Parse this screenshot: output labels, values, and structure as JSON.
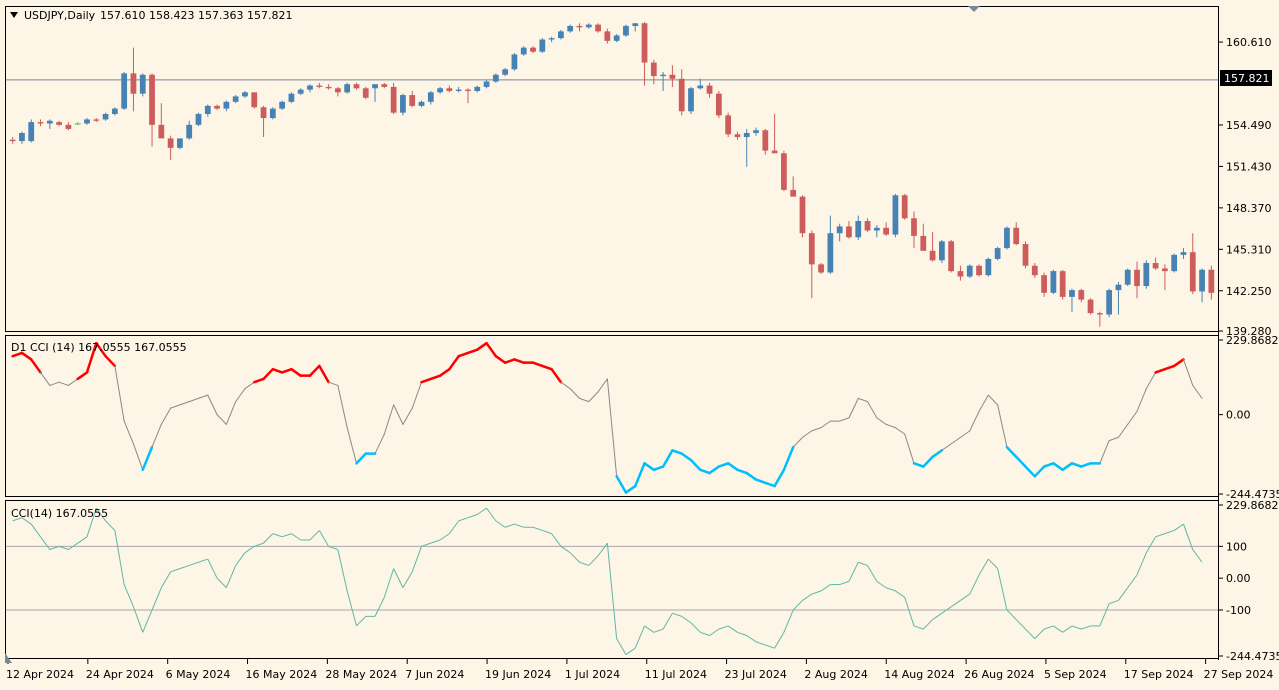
{
  "symbol_header": "USDJPY,Daily",
  "ohlc_readout": "157.610 158.423 157.363 157.821",
  "current_price_label": "157.821",
  "cci_d1_legend": "D1 CCI (14) 167.0555 167.0555",
  "cci_legend": "CCI(14) 167.0555",
  "colors": {
    "background": "#fdf5e6",
    "bull_candle": "#4682b4",
    "bear_candle": "#cd5c5c",
    "doji_candle": "#32cd32",
    "cci_upper": "#ff0000",
    "cci_lower": "#00bfff",
    "cci_neutral": "#8a8a8a",
    "cci_line": "#5fb8a8",
    "level_line": "#a9a9a9",
    "price_line": "#778899"
  },
  "chart_data": [
    {
      "type": "candlestick",
      "title": "USDJPY,Daily",
      "price_ticks": [
        "160.610",
        "157.821",
        "154.490",
        "151.430",
        "148.370",
        "145.310",
        "142.250",
        "139.280"
      ],
      "ylim": [
        139.28,
        163.2
      ],
      "current_price": 157.821,
      "candles": [
        {
          "o": 153.4,
          "h": 153.6,
          "l": 153.1,
          "c": 153.3
        },
        {
          "o": 153.3,
          "h": 154.0,
          "l": 153.1,
          "c": 153.9
        },
        {
          "o": 153.3,
          "h": 154.9,
          "l": 153.2,
          "c": 154.7
        },
        {
          "o": 154.7,
          "h": 154.9,
          "l": 154.4,
          "c": 154.6
        },
        {
          "o": 154.6,
          "h": 154.9,
          "l": 154.2,
          "c": 154.8
        },
        {
          "o": 154.7,
          "h": 154.8,
          "l": 154.4,
          "c": 154.5
        },
        {
          "o": 154.5,
          "h": 154.7,
          "l": 154.1,
          "c": 154.2
        },
        {
          "o": 154.6,
          "h": 154.7,
          "l": 154.5,
          "c": 154.6
        },
        {
          "o": 154.6,
          "h": 155.0,
          "l": 154.5,
          "c": 154.9
        },
        {
          "o": 154.9,
          "h": 155.0,
          "l": 154.7,
          "c": 154.8
        },
        {
          "o": 154.9,
          "h": 155.4,
          "l": 154.8,
          "c": 155.3
        },
        {
          "o": 155.3,
          "h": 155.8,
          "l": 155.2,
          "c": 155.7
        },
        {
          "o": 155.7,
          "h": 158.4,
          "l": 155.6,
          "c": 158.3
        },
        {
          "o": 158.3,
          "h": 160.2,
          "l": 155.5,
          "c": 156.8
        },
        {
          "o": 156.8,
          "h": 158.3,
          "l": 156.6,
          "c": 158.2
        },
        {
          "o": 158.2,
          "h": 158.3,
          "l": 152.9,
          "c": 154.5
        },
        {
          "o": 154.5,
          "h": 156.1,
          "l": 153.6,
          "c": 153.5
        },
        {
          "o": 153.5,
          "h": 153.7,
          "l": 151.9,
          "c": 152.8
        },
        {
          "o": 152.8,
          "h": 153.4,
          "l": 152.7,
          "c": 153.5
        },
        {
          "o": 153.5,
          "h": 154.8,
          "l": 153.4,
          "c": 154.5
        },
        {
          "o": 154.5,
          "h": 155.4,
          "l": 154.4,
          "c": 155.3
        },
        {
          "o": 155.3,
          "h": 156.0,
          "l": 155.1,
          "c": 155.9
        },
        {
          "o": 155.9,
          "h": 156.0,
          "l": 155.6,
          "c": 155.7
        },
        {
          "o": 155.7,
          "h": 156.3,
          "l": 155.5,
          "c": 156.2
        },
        {
          "o": 156.2,
          "h": 156.7,
          "l": 156.1,
          "c": 156.6
        },
        {
          "o": 156.6,
          "h": 157.0,
          "l": 156.5,
          "c": 156.9
        },
        {
          "o": 156.9,
          "h": 156.9,
          "l": 155.7,
          "c": 155.8
        },
        {
          "o": 155.8,
          "h": 155.9,
          "l": 153.6,
          "c": 155.0
        },
        {
          "o": 155.0,
          "h": 155.8,
          "l": 154.9,
          "c": 155.7
        },
        {
          "o": 155.7,
          "h": 156.3,
          "l": 155.6,
          "c": 156.2
        },
        {
          "o": 156.2,
          "h": 156.9,
          "l": 156.1,
          "c": 156.8
        },
        {
          "o": 156.8,
          "h": 157.2,
          "l": 156.7,
          "c": 157.1
        },
        {
          "o": 157.1,
          "h": 157.5,
          "l": 156.9,
          "c": 157.4
        },
        {
          "o": 157.4,
          "h": 157.6,
          "l": 157.2,
          "c": 157.3
        },
        {
          "o": 157.3,
          "h": 157.5,
          "l": 157.1,
          "c": 157.2
        },
        {
          "o": 157.2,
          "h": 157.3,
          "l": 156.6,
          "c": 156.9
        },
        {
          "o": 156.9,
          "h": 157.6,
          "l": 156.8,
          "c": 157.5
        },
        {
          "o": 157.5,
          "h": 157.6,
          "l": 157.1,
          "c": 157.2
        },
        {
          "o": 157.2,
          "h": 157.3,
          "l": 156.4,
          "c": 156.5
        },
        {
          "o": 157.2,
          "h": 157.5,
          "l": 156.2,
          "c": 157.5
        },
        {
          "o": 157.5,
          "h": 157.6,
          "l": 157.2,
          "c": 157.3
        },
        {
          "o": 157.3,
          "h": 157.6,
          "l": 155.3,
          "c": 155.4
        },
        {
          "o": 155.4,
          "h": 156.8,
          "l": 155.2,
          "c": 156.7
        },
        {
          "o": 156.7,
          "h": 157.0,
          "l": 155.8,
          "c": 155.9
        },
        {
          "o": 155.9,
          "h": 156.3,
          "l": 155.8,
          "c": 156.2
        },
        {
          "o": 156.2,
          "h": 157.0,
          "l": 156.0,
          "c": 156.9
        },
        {
          "o": 156.9,
          "h": 157.3,
          "l": 156.8,
          "c": 157.2
        },
        {
          "o": 157.2,
          "h": 157.4,
          "l": 156.9,
          "c": 157.0
        },
        {
          "o": 157.0,
          "h": 157.3,
          "l": 156.9,
          "c": 157.1
        },
        {
          "o": 157.1,
          "h": 157.2,
          "l": 156.1,
          "c": 157.0
        },
        {
          "o": 157.0,
          "h": 157.4,
          "l": 156.9,
          "c": 157.3
        },
        {
          "o": 157.3,
          "h": 157.8,
          "l": 157.2,
          "c": 157.7
        },
        {
          "o": 157.7,
          "h": 158.3,
          "l": 157.6,
          "c": 158.2
        },
        {
          "o": 158.2,
          "h": 158.7,
          "l": 158.1,
          "c": 158.6
        },
        {
          "o": 158.6,
          "h": 159.8,
          "l": 158.5,
          "c": 159.7
        },
        {
          "o": 159.7,
          "h": 160.3,
          "l": 159.6,
          "c": 160.2
        },
        {
          "o": 160.2,
          "h": 160.3,
          "l": 159.8,
          "c": 159.9
        },
        {
          "o": 159.9,
          "h": 160.9,
          "l": 159.8,
          "c": 160.8
        },
        {
          "o": 160.8,
          "h": 161.0,
          "l": 160.6,
          "c": 160.9
        },
        {
          "o": 160.9,
          "h": 161.5,
          "l": 160.8,
          "c": 161.4
        },
        {
          "o": 161.4,
          "h": 161.9,
          "l": 161.3,
          "c": 161.8
        },
        {
          "o": 161.8,
          "h": 162.0,
          "l": 161.4,
          "c": 161.7
        },
        {
          "o": 161.7,
          "h": 162.0,
          "l": 161.6,
          "c": 161.9
        },
        {
          "o": 161.9,
          "h": 162.0,
          "l": 161.3,
          "c": 161.4
        },
        {
          "o": 161.4,
          "h": 161.6,
          "l": 160.5,
          "c": 160.7
        },
        {
          "o": 160.7,
          "h": 161.2,
          "l": 160.6,
          "c": 161.1
        },
        {
          "o": 161.1,
          "h": 161.9,
          "l": 161.0,
          "c": 161.8
        },
        {
          "o": 161.8,
          "h": 162.0,
          "l": 161.4,
          "c": 162.0
        },
        {
          "o": 162.0,
          "h": 162.1,
          "l": 157.4,
          "c": 159.1
        },
        {
          "o": 159.1,
          "h": 159.3,
          "l": 157.5,
          "c": 158.1
        },
        {
          "o": 158.1,
          "h": 158.4,
          "l": 157.0,
          "c": 158.2
        },
        {
          "o": 158.2,
          "h": 158.9,
          "l": 157.3,
          "c": 157.9
        },
        {
          "o": 157.9,
          "h": 158.6,
          "l": 155.2,
          "c": 155.5
        },
        {
          "o": 155.5,
          "h": 157.3,
          "l": 155.3,
          "c": 157.2
        },
        {
          "o": 157.2,
          "h": 157.9,
          "l": 157.1,
          "c": 157.4
        },
        {
          "o": 157.4,
          "h": 157.6,
          "l": 156.5,
          "c": 156.8
        },
        {
          "o": 156.8,
          "h": 157.0,
          "l": 155.0,
          "c": 155.2
        },
        {
          "o": 155.2,
          "h": 155.4,
          "l": 153.6,
          "c": 153.8
        },
        {
          "o": 153.8,
          "h": 154.0,
          "l": 153.4,
          "c": 153.6
        },
        {
          "o": 153.6,
          "h": 154.2,
          "l": 151.4,
          "c": 153.9
        },
        {
          "o": 153.9,
          "h": 154.3,
          "l": 153.7,
          "c": 154.1
        },
        {
          "o": 154.1,
          "h": 154.2,
          "l": 152.3,
          "c": 152.6
        },
        {
          "o": 152.6,
          "h": 155.3,
          "l": 152.5,
          "c": 152.4
        },
        {
          "o": 152.4,
          "h": 152.6,
          "l": 149.6,
          "c": 149.7
        },
        {
          "o": 149.7,
          "h": 150.7,
          "l": 149.2,
          "c": 149.2
        },
        {
          "o": 149.2,
          "h": 149.3,
          "l": 146.2,
          "c": 146.5
        },
        {
          "o": 146.5,
          "h": 146.7,
          "l": 141.7,
          "c": 144.2
        },
        {
          "o": 144.2,
          "h": 144.3,
          "l": 143.5,
          "c": 143.6
        },
        {
          "o": 143.6,
          "h": 147.8,
          "l": 143.5,
          "c": 146.5
        },
        {
          "o": 146.5,
          "h": 147.2,
          "l": 145.9,
          "c": 147.0
        },
        {
          "o": 147.0,
          "h": 147.4,
          "l": 146.1,
          "c": 146.2
        },
        {
          "o": 146.2,
          "h": 147.8,
          "l": 146.0,
          "c": 147.4
        },
        {
          "o": 147.4,
          "h": 147.6,
          "l": 146.6,
          "c": 146.7
        },
        {
          "o": 146.7,
          "h": 147.1,
          "l": 146.2,
          "c": 146.9
        },
        {
          "o": 146.9,
          "h": 147.3,
          "l": 146.3,
          "c": 146.4
        },
        {
          "o": 146.4,
          "h": 149.4,
          "l": 146.2,
          "c": 149.3
        },
        {
          "o": 149.3,
          "h": 149.4,
          "l": 147.5,
          "c": 147.6
        },
        {
          "o": 147.6,
          "h": 148.1,
          "l": 145.4,
          "c": 146.3
        },
        {
          "o": 146.3,
          "h": 147.2,
          "l": 146.0,
          "c": 145.2
        },
        {
          "o": 145.2,
          "h": 146.6,
          "l": 144.4,
          "c": 144.5
        },
        {
          "o": 144.5,
          "h": 146.0,
          "l": 144.3,
          "c": 145.9
        },
        {
          "o": 145.9,
          "h": 146.0,
          "l": 143.6,
          "c": 143.7
        },
        {
          "o": 143.7,
          "h": 144.1,
          "l": 143.0,
          "c": 143.3
        },
        {
          "o": 143.3,
          "h": 144.2,
          "l": 143.2,
          "c": 144.1
        },
        {
          "o": 144.1,
          "h": 144.2,
          "l": 143.3,
          "c": 143.4
        },
        {
          "o": 143.4,
          "h": 144.7,
          "l": 143.3,
          "c": 144.6
        },
        {
          "o": 144.6,
          "h": 145.5,
          "l": 144.5,
          "c": 145.4
        },
        {
          "o": 145.4,
          "h": 147.0,
          "l": 145.3,
          "c": 146.9
        },
        {
          "o": 146.9,
          "h": 147.3,
          "l": 145.6,
          "c": 145.7
        },
        {
          "o": 145.7,
          "h": 145.9,
          "l": 143.9,
          "c": 144.1
        },
        {
          "o": 144.1,
          "h": 144.3,
          "l": 143.2,
          "c": 143.4
        },
        {
          "o": 143.4,
          "h": 143.6,
          "l": 141.8,
          "c": 142.1
        },
        {
          "o": 142.1,
          "h": 143.8,
          "l": 142.0,
          "c": 143.7
        },
        {
          "o": 143.7,
          "h": 143.8,
          "l": 141.6,
          "c": 141.8
        },
        {
          "o": 141.8,
          "h": 142.4,
          "l": 140.7,
          "c": 142.3
        },
        {
          "o": 142.3,
          "h": 142.4,
          "l": 141.4,
          "c": 141.6
        },
        {
          "o": 141.6,
          "h": 141.7,
          "l": 140.5,
          "c": 140.6
        },
        {
          "o": 140.6,
          "h": 140.7,
          "l": 139.6,
          "c": 140.5
        },
        {
          "o": 140.5,
          "h": 142.4,
          "l": 140.3,
          "c": 142.3
        },
        {
          "o": 142.3,
          "h": 142.9,
          "l": 140.5,
          "c": 142.7
        },
        {
          "o": 142.7,
          "h": 143.9,
          "l": 142.6,
          "c": 143.8
        },
        {
          "o": 143.8,
          "h": 144.4,
          "l": 141.7,
          "c": 142.6
        },
        {
          "o": 142.6,
          "h": 144.5,
          "l": 142.4,
          "c": 144.3
        },
        {
          "o": 144.3,
          "h": 144.7,
          "l": 143.8,
          "c": 143.9
        },
        {
          "o": 143.9,
          "h": 144.2,
          "l": 142.3,
          "c": 143.7
        },
        {
          "o": 143.7,
          "h": 145.0,
          "l": 143.6,
          "c": 144.9
        },
        {
          "o": 144.9,
          "h": 145.4,
          "l": 144.6,
          "c": 145.1
        },
        {
          "o": 145.1,
          "h": 146.5,
          "l": 142.0,
          "c": 142.2
        },
        {
          "o": 142.2,
          "h": 143.9,
          "l": 141.4,
          "c": 143.8
        },
        {
          "o": 143.8,
          "h": 144.1,
          "l": 141.6,
          "c": 142.1
        }
      ]
    },
    {
      "type": "line",
      "title": "D1 CCI (14) 167.0555 167.0555",
      "y_ticks": [
        "229.8682",
        "0.00",
        "-244.4735"
      ],
      "ylim": [
        -244.4735,
        229.8682
      ],
      "thresholds": [
        100,
        -100
      ],
      "values": [
        180,
        190,
        170,
        130,
        90,
        100,
        90,
        110,
        130,
        220,
        180,
        150,
        -20,
        -90,
        -170,
        -100,
        -30,
        20,
        30,
        40,
        50,
        60,
        0,
        -30,
        40,
        80,
        100,
        110,
        140,
        130,
        140,
        120,
        120,
        150,
        100,
        90,
        -40,
        -150,
        -120,
        -120,
        -60,
        30,
        -30,
        20,
        100,
        110,
        120,
        140,
        180,
        190,
        200,
        220,
        180,
        160,
        170,
        160,
        160,
        150,
        140,
        100,
        80,
        50,
        40,
        70,
        110,
        -190,
        -240,
        -220,
        -150,
        -170,
        -160,
        -110,
        -120,
        -140,
        -170,
        -180,
        -160,
        -150,
        -170,
        -180,
        -200,
        -210,
        -220,
        -170,
        -100,
        -70,
        -50,
        -40,
        -20,
        -20,
        -10,
        50,
        40,
        -10,
        -30,
        -40,
        -60,
        -150,
        -160,
        -130,
        -110,
        -90,
        -70,
        -50,
        10,
        60,
        30,
        -100,
        -130,
        -160,
        -190,
        -160,
        -150,
        -170,
        -150,
        -160,
        -150,
        -150,
        -80,
        -70,
        -30,
        10,
        80,
        130,
        140,
        150,
        170,
        90,
        50
      ]
    },
    {
      "type": "line",
      "title": "CCI(14) 167.0555",
      "y_ticks": [
        "229.8682",
        "100",
        "0.00",
        "-100",
        "-244.4735"
      ],
      "ylim": [
        -244.4735,
        229.8682
      ],
      "levels": [
        100,
        -100
      ]
    }
  ],
  "x_tick_labels": [
    "12 Apr 2024",
    "24 Apr 2024",
    "6 May 2024",
    "16 May 2024",
    "28 May 2024",
    "7 Jun 2024",
    "19 Jun 2024",
    "1 Jul 2024",
    "11 Jul 2024",
    "23 Jul 2024",
    "2 Aug 2024",
    "14 Aug 2024",
    "26 Aug 2024",
    "5 Sep 2024",
    "17 Sep 2024",
    "27 Sep 2024"
  ]
}
